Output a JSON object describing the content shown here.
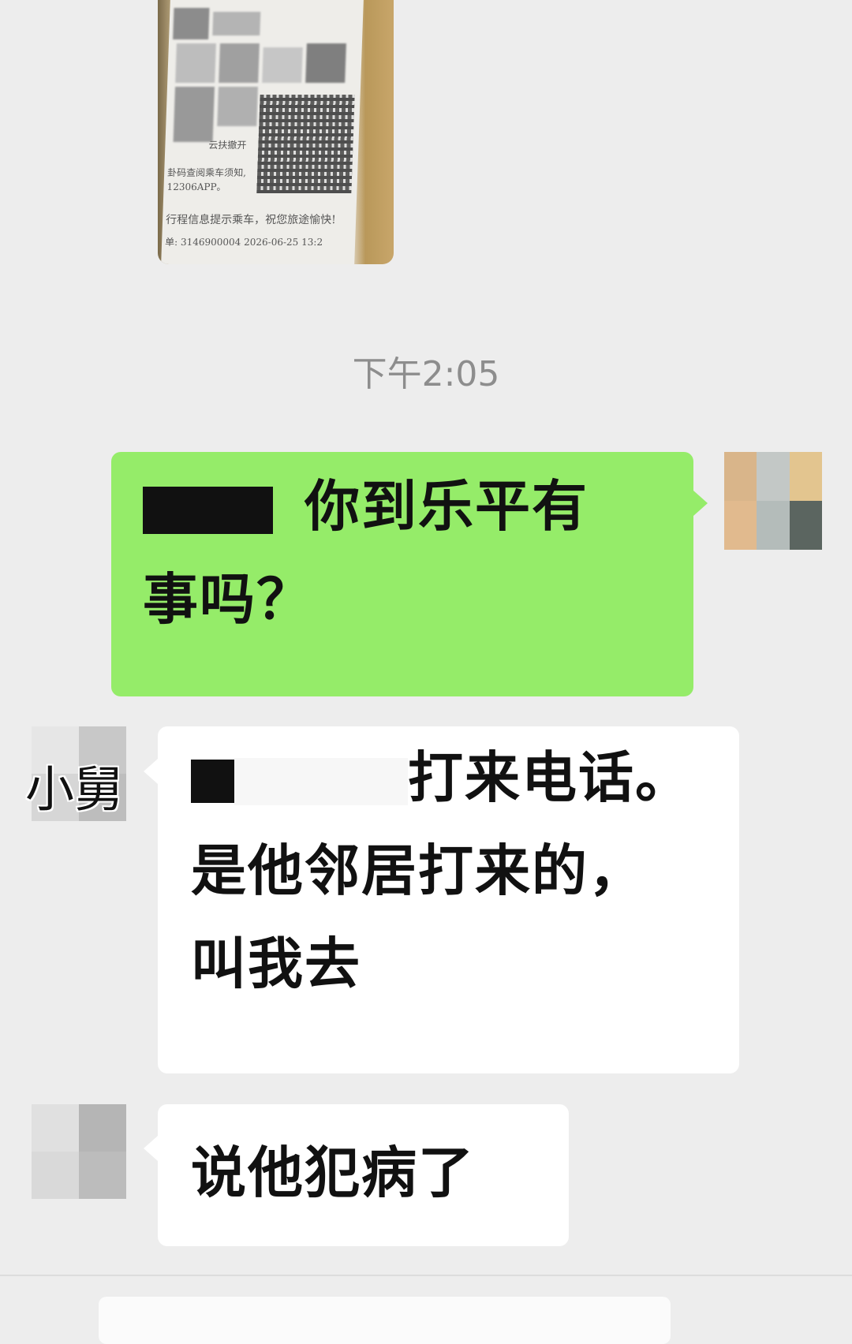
{
  "timestamp": "下午2:05",
  "ticket": {
    "lines": [
      "云扶撤开",
      "卦码查阅乘车须知,",
      "12306APP。",
      "行程信息提示乘车，祝您旅途愉快!",
      "单: 3146900004 2026-06-25 13:2"
    ]
  },
  "messages": [
    {
      "side": "right",
      "text_line1": "你到乐平有",
      "text_line2": "事吗？"
    },
    {
      "side": "left",
      "contact_label": "小舅",
      "text_line1": "打来电话。",
      "text_line2": "是他邻居打来的，",
      "text_line3": "叫我去"
    },
    {
      "side": "left",
      "text_line1": "说他犯病了"
    }
  ],
  "colors": {
    "background": "#ededed",
    "sent_bubble": "#95ec69",
    "received_bubble": "#ffffff",
    "timestamp": "#8d8d8d"
  }
}
